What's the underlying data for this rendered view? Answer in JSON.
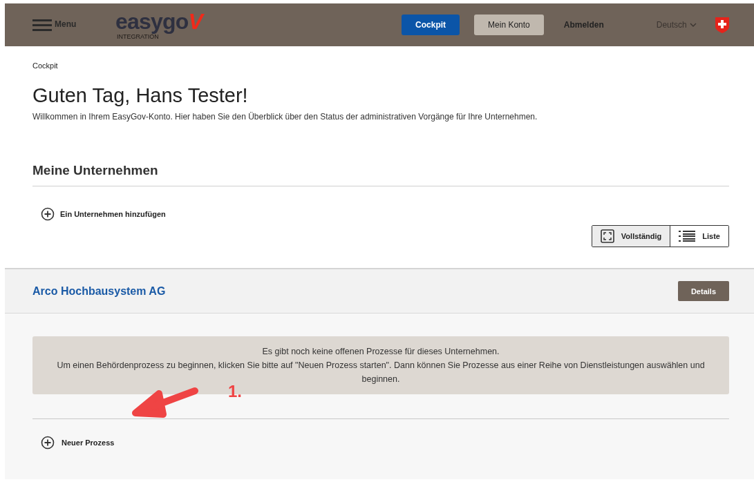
{
  "header": {
    "menu_label": "Menu",
    "logo": {
      "main": "easygo",
      "accent": "V",
      "sub": "INTEGRATION"
    },
    "nav": [
      {
        "label": "Cockpit",
        "kind": "primary"
      },
      {
        "label": "Mein Konto",
        "kind": "secondary"
      },
      {
        "label": "Abmelden",
        "kind": "link"
      }
    ],
    "language": "Deutsch"
  },
  "breadcrumb": "Cockpit",
  "greeting": "Guten Tag, Hans Tester!",
  "intro": "Willkommen in Ihrem EasyGov-Konto. Hier haben Sie den Überblick über den Status der administrativen Vorgänge für Ihre Unternehmen.",
  "companies_section": {
    "title": "Meine Unternehmen",
    "add_label": "Ein Unternehmen hinzufügen",
    "views": [
      {
        "label": "Vollständig",
        "kind": "full",
        "selected": true
      },
      {
        "label": "Liste",
        "kind": "list",
        "selected": false
      }
    ]
  },
  "company": {
    "name": "Arco Hochbausystem AG",
    "details_button": "Details",
    "notice": [
      "Es gibt noch keine offenen Prozesse für dieses Unternehmen.",
      "Um einen Behördenprozess zu beginnen, klicken Sie bitte auf \"Neuen Prozess starten\". Dann können Sie Prozesse aus einer Reihe von Dienstleistungen auswählen und beginnen."
    ],
    "new_process_label": "Neuer Prozess"
  },
  "annotation": {
    "label": "1."
  }
}
